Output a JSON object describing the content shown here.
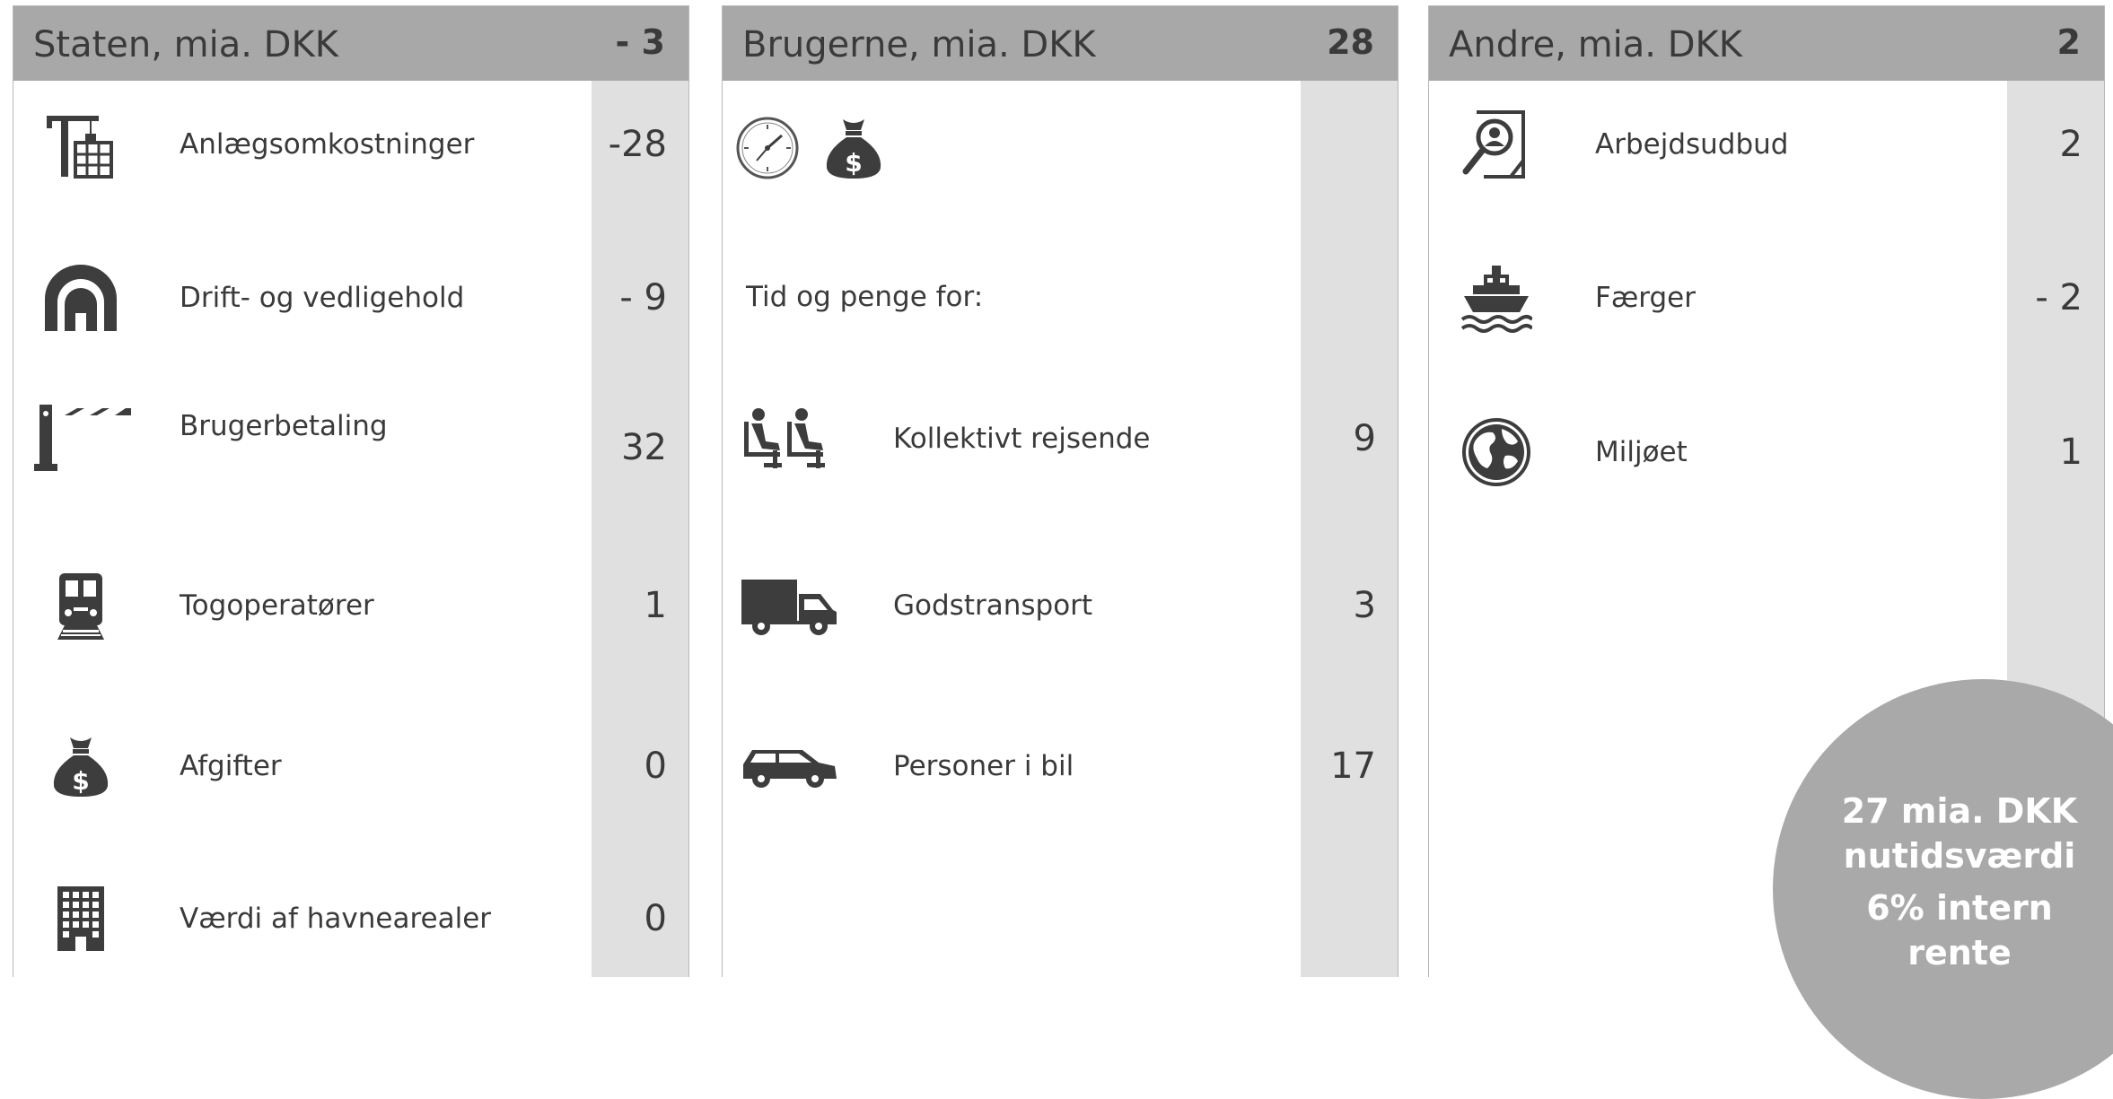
{
  "colors": {
    "header_bg": "#a8a8a8",
    "value_column_bg": "#e0e0e0",
    "icon": "#3d3d3d",
    "circle_bg": "#a9a9a9",
    "text": "#3a3a3a"
  },
  "staten": {
    "title": "Staten, mia. DKK",
    "total": "- 3",
    "rows": [
      {
        "icon": "crane-building-icon",
        "label": "Anlægsomkostninger",
        "value": "-28"
      },
      {
        "icon": "tunnel-icon",
        "label": "Drift- og vedligehold",
        "value": "- 9"
      },
      {
        "icon": "toll-barrier-icon",
        "label": "Brugerbetaling",
        "value": "32"
      },
      {
        "icon": "train-icon",
        "label": "Togoperatører",
        "value": "1"
      },
      {
        "icon": "money-bag-icon",
        "label": "Afgifter",
        "value": "0"
      },
      {
        "icon": "building-icon",
        "label": "Værdi af havnearealer",
        "value": "0"
      }
    ]
  },
  "brugerne": {
    "title": "Brugerne, mia. DKK",
    "total": "28",
    "top_icons": [
      "clock-icon",
      "money-bag-icon"
    ],
    "note": "Tid og penge for:",
    "rows": [
      {
        "icon": "seated-passengers-icon",
        "label": "Kollektivt rejsende",
        "value": "9"
      },
      {
        "icon": "truck-icon",
        "label": "Godstransport",
        "value": "3"
      },
      {
        "icon": "car-icon",
        "label": "Personer i bil",
        "value": "17"
      }
    ]
  },
  "andre": {
    "title": "Andre, mia. DKK",
    "total": "2",
    "rows": [
      {
        "icon": "job-search-icon",
        "label": "Arbejdsudbud",
        "value": "2"
      },
      {
        "icon": "ferry-icon",
        "label": "Færger",
        "value": "- 2"
      },
      {
        "icon": "globe-icon",
        "label": "Miljøet",
        "value": "1"
      }
    ]
  },
  "summary": {
    "line1": "27 mia. DKK",
    "line2": "nutidsværdi",
    "line3": "6% intern",
    "line4": "rente"
  }
}
